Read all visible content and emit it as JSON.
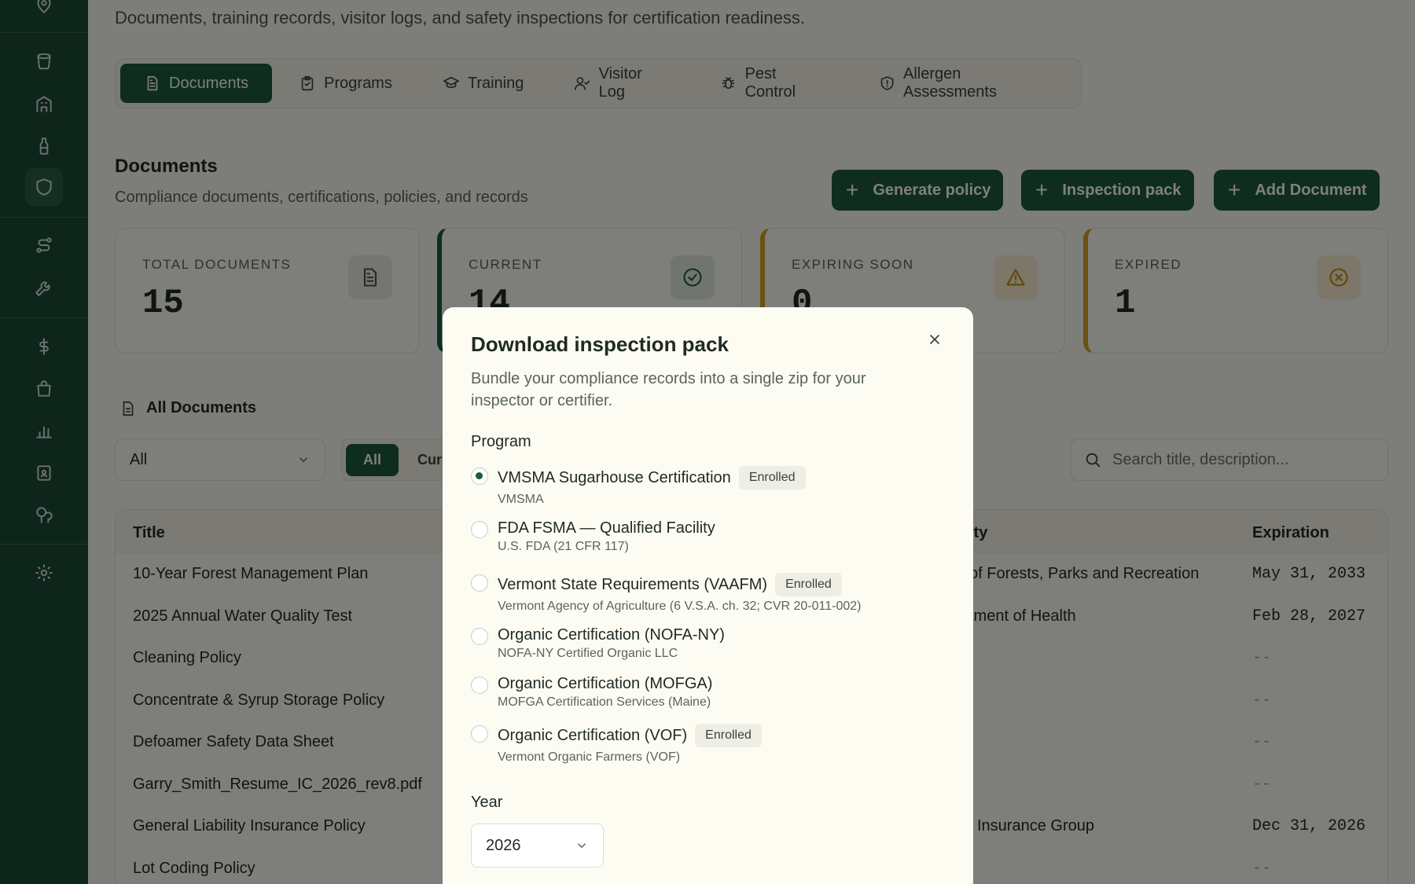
{
  "page": {
    "description": "Documents, training records, visitor logs, and safety inspections for certification readiness."
  },
  "tabs": [
    {
      "label": "Documents",
      "icon": "document-icon",
      "active": true
    },
    {
      "label": "Programs",
      "icon": "clipboard-icon"
    },
    {
      "label": "Training",
      "icon": "graduation-cap-icon"
    },
    {
      "label": "Visitor Log",
      "icon": "user-check-icon"
    },
    {
      "label": "Pest Control",
      "icon": "bug-icon"
    },
    {
      "label": "Allergen Assessments",
      "icon": "shield-alert-icon"
    }
  ],
  "section": {
    "title": "Documents",
    "subtitle": "Compliance documents, certifications, policies, and records"
  },
  "actions": {
    "generate_policy": "Generate policy",
    "inspection_pack": "Inspection pack",
    "add_document": "Add Document"
  },
  "stats": [
    {
      "label": "TOTAL DOCUMENTS",
      "value": "15",
      "icon": "document-icon"
    },
    {
      "label": "CURRENT",
      "value": "14",
      "icon": "check-circle-icon",
      "accent": "#1d5a3e"
    },
    {
      "label": "EXPIRING SOON",
      "value": "0",
      "icon": "warning-icon",
      "accent": "#d7a020"
    },
    {
      "label": "EXPIRED",
      "value": "1",
      "icon": "x-circle-icon",
      "accent": "#d7a020"
    }
  ],
  "list": {
    "heading": "All Documents",
    "filter_value": "All",
    "segment_on": "All",
    "segment_off": "Curr",
    "search_placeholder": "Search title, description..."
  },
  "table": {
    "headers": {
      "title": "Title",
      "authority": "ity",
      "expiration": "Expiration"
    },
    "rows": [
      {
        "title": "10-Year Forest Management Plan",
        "authority": "of Forests, Parks and Recreation",
        "expiration": "May 31, 2033"
      },
      {
        "title": "2025 Annual Water Quality Test",
        "authority": "tment of Health",
        "expiration": "Feb 28, 2027"
      },
      {
        "title": "Cleaning Policy",
        "authority": "",
        "expiration": "--"
      },
      {
        "title": "Concentrate & Syrup Storage Policy",
        "authority": "",
        "expiration": "--"
      },
      {
        "title": "Defoamer Safety Data Sheet",
        "authority": "",
        "expiration": "--"
      },
      {
        "title": "Garry_Smith_Resume_IC_2026_rev8.pdf",
        "authority": "",
        "expiration": "--"
      },
      {
        "title": "General Liability Insurance Policy",
        "authority": "l Insurance Group",
        "expiration": "Dec 31, 2026"
      },
      {
        "title": "Lot Coding Policy",
        "authority": "",
        "expiration": "--"
      }
    ]
  },
  "modal": {
    "title": "Download inspection pack",
    "description": "Bundle your compliance records into a single zip for your inspector or certifier.",
    "program_label": "Program",
    "programs": [
      {
        "name": "VMSMA Sugarhouse Certification",
        "sub": "VMSMA",
        "badge": "Enrolled",
        "checked": true
      },
      {
        "name": "FDA FSMA — Qualified Facility",
        "sub": "U.S. FDA (21 CFR 117)",
        "badge": ""
      },
      {
        "name": "Vermont State Requirements (VAAFM)",
        "sub": "Vermont Agency of Agriculture (6 V.S.A. ch. 32; CVR 20-011-002)",
        "badge": "Enrolled"
      },
      {
        "name": "Organic Certification (NOFA-NY)",
        "sub": "NOFA-NY Certified Organic LLC",
        "badge": ""
      },
      {
        "name": "Organic Certification (MOFGA)",
        "sub": "MOFGA Certification Services (Maine)",
        "badge": ""
      },
      {
        "name": "Organic Certification (VOF)",
        "sub": "Vermont Organic Farmers (VOF)",
        "badge": "Enrolled"
      }
    ],
    "year_label": "Year",
    "year_value": "2026"
  }
}
